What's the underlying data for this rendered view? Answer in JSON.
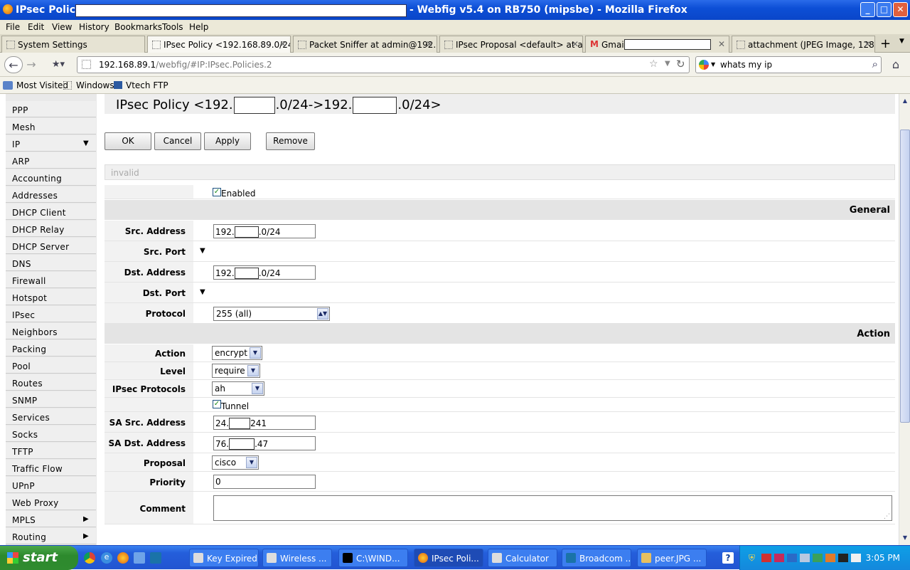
{
  "window": {
    "title_prefix": "IPsec Policy <",
    "title_suffix": "- Webfig v5.4 on RB750 (mipsbe) - Mozilla Firefox",
    "min": "_",
    "max": "□",
    "close": "✕"
  },
  "menu": [
    "File",
    "Edit",
    "View",
    "History",
    "Bookmarks",
    "Tools",
    "Help"
  ],
  "tabs": [
    "System Settings",
    "IPsec Policy <192.168.89.0/24-...",
    "Packet Sniffer at admin@192.1...",
    "IPsec Proposal <default> at ad...",
    "Gmail -",
    "attachment (JPEG Image, 1280 ..."
  ],
  "nav": {
    "url_host": "192.168.89.1",
    "url_path": "/webfig/#IP:IPsec.Policies.2",
    "search": "whats my ip"
  },
  "bookmarks": [
    "Most Visited",
    "Windows",
    "Vtech FTP"
  ],
  "sidebar": [
    "PPP",
    "Mesh",
    "IP",
    "ARP",
    "Accounting",
    "Addresses",
    "DHCP Client",
    "DHCP Relay",
    "DHCP Server",
    "DNS",
    "Firewall",
    "Hotspot",
    "IPsec",
    "Neighbors",
    "Packing",
    "Pool",
    "Routes",
    "SNMP",
    "Services",
    "Socks",
    "TFTP",
    "Traffic Flow",
    "UPnP",
    "Web Proxy",
    "MPLS",
    "Routing"
  ],
  "page": {
    "h1": "IPsec Policy <192.",
    "h2": ".0/24->192.",
    "h3": ".0/24>",
    "buttons": {
      "ok": "OK",
      "cancel": "Cancel",
      "apply": "Apply",
      "remove": "Remove"
    },
    "status": "invalid",
    "enabled_label": "Enabled",
    "general": "General",
    "src_address_label": "Src. Address",
    "src_a": "192.",
    "src_b": ".0/24",
    "src_port_label": "Src. Port",
    "dst_address_label": "Dst. Address",
    "dst_a": "192.",
    "dst_b": ".0/24",
    "dst_port_label": "Dst. Port",
    "protocol_label": "Protocol",
    "protocol": "255 (all)",
    "action_section": "Action",
    "action_label": "Action",
    "action": "encrypt",
    "level_label": "Level",
    "level": "require",
    "ipsec_protocols_label": "IPsec Protocols",
    "ipsec_protocols": "ah",
    "tunnel_label": "Tunnel",
    "sa_src_label": "SA Src. Address",
    "sa_src_a": "24.",
    "sa_src_b": "241",
    "sa_dst_label": "SA Dst. Address",
    "sa_dst_a": "76.",
    "sa_dst_b": ".47",
    "proposal_label": "Proposal",
    "proposal": "cisco",
    "priority_label": "Priority",
    "priority": "0",
    "comment_label": "Comment"
  },
  "taskbar": {
    "start": "start",
    "items": [
      "Key Expired",
      "Wireless ...",
      "C:\\WIND...",
      "IPsec Poli...",
      "Calculator",
      "Broadcom ...",
      "peer.JPG ..."
    ],
    "clock": "3:05 PM"
  }
}
